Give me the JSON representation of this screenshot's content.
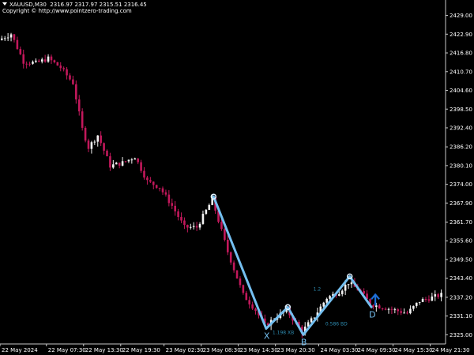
{
  "header": {
    "symbol": "XAUUSD,M30",
    "ohlc": "2316.97 2317.97 2315.51 2316.45",
    "copyright": "Copyright © http://www.pointzero-trading.com"
  },
  "colors": {
    "background": "#000000",
    "bull_candle": "#f2f2f2",
    "bear_candle": "#c2185b",
    "pattern_line": "#74bff0",
    "ratio_text": "#2e8bb0",
    "marker_arrow": "#1e6fd8"
  },
  "pattern": {
    "point_labels": [
      "X",
      "B",
      "D"
    ],
    "ratios": [
      "1.198 XB",
      "0.586 BD",
      "1.2"
    ]
  },
  "chart_data": {
    "type": "candlestick",
    "symbol": "XAUUSD",
    "timeframe": "M30",
    "ylim": [
      2322.0,
      2433.0
    ],
    "y_ticks": [
      2429.0,
      2422.9,
      2416.8,
      2410.7,
      2404.6,
      2398.5,
      2392.4,
      2386.2,
      2380.1,
      2374.0,
      2367.9,
      2361.7,
      2355.6,
      2349.5,
      2343.4,
      2337.2,
      2331.1,
      2325.0
    ],
    "x_ticks": [
      "22 May 2024",
      "22 May 07:30",
      "22 May 13:30",
      "22 May 19:30",
      "23 May 02:30",
      "23 May 08:30",
      "23 May 14:30",
      "23 May 20:30",
      "24 May 03:30",
      "24 May 09:30",
      "24 May 15:30",
      "24 May 21:30"
    ],
    "key_points": [
      {
        "x": "23 May 10:30",
        "y": 2370.0
      },
      {
        "label": "X",
        "x": "23 May 19:00",
        "y": 2327.0
      },
      {
        "x": "23 May 22:30",
        "y": 2334.0
      },
      {
        "label": "B",
        "x": "24 May 01:00",
        "y": 2325.0
      },
      {
        "x": "24 May 08:30",
        "y": 2344.0
      },
      {
        "label": "D",
        "x": "24 May 12:00",
        "y": 2334.0
      }
    ],
    "close_path": [
      {
        "x": "22 May 00:00",
        "y": 2421.0
      },
      {
        "x": "22 May 02:00",
        "y": 2423.0
      },
      {
        "x": "22 May 04:00",
        "y": 2414.0
      },
      {
        "x": "22 May 06:00",
        "y": 2413.5
      },
      {
        "x": "22 May 08:00",
        "y": 2415.0
      },
      {
        "x": "22 May 10:00",
        "y": 2412.0
      },
      {
        "x": "22 May 12:00",
        "y": 2407.0
      },
      {
        "x": "22 May 13:30",
        "y": 2392.0
      },
      {
        "x": "22 May 14:30",
        "y": 2386.0
      },
      {
        "x": "22 May 16:00",
        "y": 2390.0
      },
      {
        "x": "22 May 18:00",
        "y": 2380.0
      },
      {
        "x": "22 May 20:00",
        "y": 2381.0
      },
      {
        "x": "22 May 22:00",
        "y": 2383.0
      },
      {
        "x": "23 May 00:00",
        "y": 2375.0
      },
      {
        "x": "23 May 02:00",
        "y": 2373.0
      },
      {
        "x": "23 May 04:00",
        "y": 2367.0
      },
      {
        "x": "23 May 06:00",
        "y": 2360.0
      },
      {
        "x": "23 May 08:00",
        "y": 2360.0
      },
      {
        "x": "23 May 10:30",
        "y": 2369.0
      },
      {
        "x": "23 May 13:00",
        "y": 2352.0
      },
      {
        "x": "23 May 15:30",
        "y": 2338.0
      },
      {
        "x": "23 May 17:30",
        "y": 2333.0
      },
      {
        "x": "23 May 19:00",
        "y": 2328.0
      },
      {
        "x": "23 May 21:00",
        "y": 2331.0
      },
      {
        "x": "23 May 22:30",
        "y": 2333.0
      },
      {
        "x": "24 May 01:00",
        "y": 2326.0
      },
      {
        "x": "24 May 03:00",
        "y": 2331.0
      },
      {
        "x": "24 May 05:00",
        "y": 2337.0
      },
      {
        "x": "24 May 07:00",
        "y": 2339.0
      },
      {
        "x": "24 May 08:30",
        "y": 2342.0
      },
      {
        "x": "24 May 10:30",
        "y": 2339.0
      },
      {
        "x": "24 May 12:00",
        "y": 2335.0
      },
      {
        "x": "24 May 14:00",
        "y": 2334.0
      },
      {
        "x": "24 May 16:00",
        "y": 2333.0
      },
      {
        "x": "24 May 18:00",
        "y": 2332.0
      },
      {
        "x": "24 May 20:00",
        "y": 2336.0
      },
      {
        "x": "24 May 23:30",
        "y": 2338.0
      }
    ]
  }
}
